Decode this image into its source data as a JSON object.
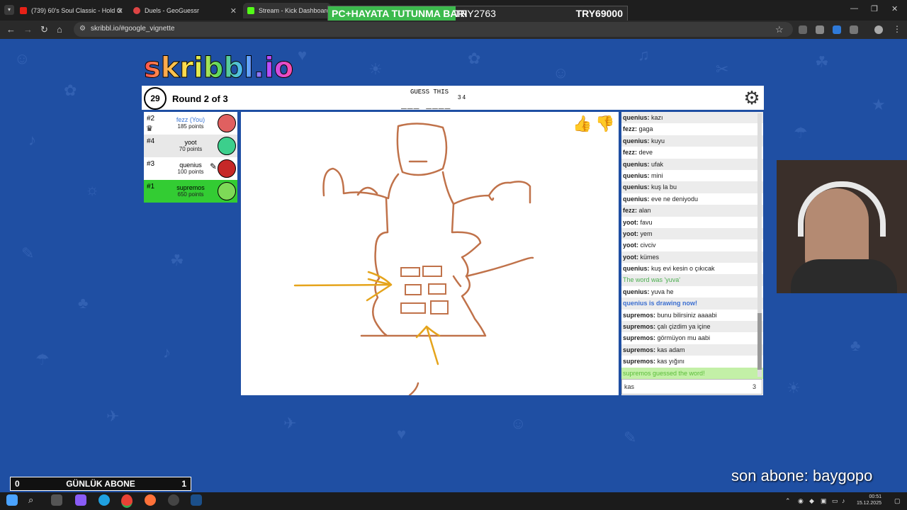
{
  "browser": {
    "tabs": [
      {
        "title": "(739) 60's Soul Classic - Hold O",
        "fav": "#e62117"
      },
      {
        "title": "Duels - GeoGuessr",
        "fav": "#d44"
      },
      {
        "title": "Stream - Kick Dashboard",
        "fav": "#53fc18"
      }
    ],
    "url": "skribbl.io/#google_vignette",
    "overlay_left": "PC+HAYATA TUTUNMA BARI",
    "overlay_mid": "TRY2763",
    "overlay_right": "TRY69000"
  },
  "game": {
    "logo": "skribbl.io",
    "timer": "29",
    "round_label": "Round 2 of 3",
    "guess_title": "GUESS THIS",
    "hint": "___ ____",
    "hint_len": "3 4",
    "players": [
      {
        "rank": "#2",
        "name": "fezz (You)",
        "score": "185 points",
        "crown": "♛",
        "avatar": "#e06060"
      },
      {
        "rank": "#4",
        "name": "yoot",
        "score": "70 points",
        "crown": "",
        "avatar": "#3ccf8c"
      },
      {
        "rank": "#3",
        "name": "quenius",
        "score": "100 points",
        "crown": "",
        "avatar": "#c62828"
      },
      {
        "rank": "#1",
        "name": "supremos",
        "score": "650 points",
        "crown": "",
        "avatar": "#7ed957"
      }
    ]
  },
  "chat": {
    "messages": [
      {
        "user": "quenius:",
        "text": " kazı"
      },
      {
        "user": "fezz:",
        "text": " gaga"
      },
      {
        "user": "quenius:",
        "text": " kuyu"
      },
      {
        "user": "fezz:",
        "text": " deve"
      },
      {
        "user": "quenius:",
        "text": " ufak"
      },
      {
        "user": "quenius:",
        "text": " mini"
      },
      {
        "user": "quenius:",
        "text": " kuş la bu"
      },
      {
        "user": "quenius:",
        "text": " eve ne deniyodu"
      },
      {
        "user": "fezz:",
        "text": " alan"
      },
      {
        "user": "yoot:",
        "text": " favu"
      },
      {
        "user": "yoot:",
        "text": " yem"
      },
      {
        "user": "yoot:",
        "text": " civciv"
      },
      {
        "user": "yoot:",
        "text": " kümes"
      },
      {
        "user": "quenius:",
        "text": " kuş evi kesin o çıkıcak"
      },
      {
        "user": "",
        "text": "The word was 'yuva'"
      },
      {
        "user": "quenius:",
        "text": " yuva he"
      },
      {
        "user": "",
        "text": "quenius is drawing now!"
      },
      {
        "user": "supremos:",
        "text": " bunu bilirsiniz aaaabi"
      },
      {
        "user": "supremos:",
        "text": " çalı çizdim ya içine"
      },
      {
        "user": "supremos:",
        "text": " görmüyon mu aabi"
      },
      {
        "user": "supremos:",
        "text": " kas adam"
      },
      {
        "user": "supremos:",
        "text": " kas yığını"
      },
      {
        "user": "",
        "text": "supremos guessed the word!"
      }
    ],
    "input_value": "kas",
    "input_count": "3"
  },
  "stream": {
    "abone_left": "0",
    "abone_label": "GÜNLÜK ABONE",
    "abone_right": "1",
    "son_abone": "son abone: baygopo"
  },
  "taskbar": {
    "time": "00:51",
    "date": "15.12.2025"
  }
}
